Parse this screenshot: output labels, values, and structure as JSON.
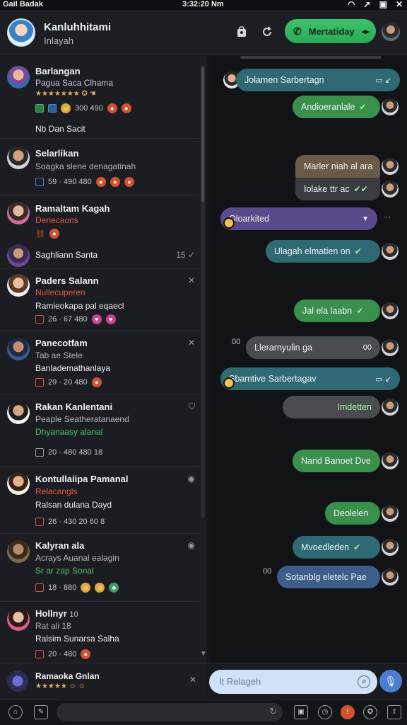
{
  "status": {
    "left": "Gail Badak",
    "time": "3:32:20 Nm",
    "icons": [
      "wifi-icon",
      "signal-icon",
      "battery-icon",
      "close-icon"
    ]
  },
  "header": {
    "title": "Kanluhhitami",
    "subtitle": "Inlayah",
    "call_label": "Mertatiday"
  },
  "contacts": [
    {
      "name": "Barlangan",
      "sub": "Pagua Saca Clhama",
      "sub_color": "#c9cad0",
      "line": "Nb Dan Sacit",
      "meta": "300  490"
    },
    {
      "name": "Selarlikan",
      "sub": "Soagka slene denagatinah",
      "sub_color": "#b3b4ba",
      "meta": "59 · 490  480"
    },
    {
      "name": "Ramaltam Kagah",
      "sub": "Deriecaons",
      "sub_color": "#e15a45"
    },
    {
      "name": "Saghliann Santa",
      "meta_right": "15"
    },
    {
      "name": "Paders Salann",
      "sub": "Nullecuperen",
      "sub_color": "#e15a45",
      "line": "Ramieokapa pal eqaecl",
      "meta": "26 · 67  480"
    },
    {
      "name": "Panecotfam",
      "sub": "Tab ae Stele",
      "sub_color": "#b3b4ba",
      "line": "Banlademathanlaya",
      "meta": "29 · 20  480"
    },
    {
      "name": "Rakan Kanlentani",
      "sub": "Peaple Seatheratanaend",
      "sub_color": "#b3b4ba",
      "line": "Dhyanaasy alanal",
      "line_color": "#4cc46a",
      "meta": "20 · 480  480  18"
    },
    {
      "name": "Kontullaiipa Pamanal",
      "sub": "Relacangls",
      "sub_color": "#e15a45",
      "line": "Ralsan dulana Dayd",
      "meta": "26 · 430  20  60  8"
    },
    {
      "name": "Kalyran ala",
      "sub": "Acrays Auanal ealagin",
      "sub_color": "#b3b4ba",
      "line": "Sr ar zap Sonal",
      "line_color": "#4cc46a",
      "meta": "18 · 880"
    },
    {
      "name": "Hollnyr",
      "name_suffix": "10",
      "sub": "Rat ali 18",
      "sub_color": "#b3b4ba",
      "line": "Ralsim Sunarsa Salha",
      "meta": "20 · 480"
    }
  ],
  "pinned_bottom": {
    "name": "Ramaoka Gnlan"
  },
  "messages": [
    {
      "text": "Jolamen Sarbertagn",
      "style": "teal"
    },
    {
      "text": "Andioeranlale",
      "style": "green"
    },
    {
      "text": "Marler niah al ara",
      "style": "brown"
    },
    {
      "text": "Iolake ttr ac",
      "style": "dark"
    },
    {
      "text": "Oloarkited",
      "style": "purple"
    },
    {
      "text": "Ulagah elmatien on",
      "style": "teal"
    },
    {
      "text": "Jal ela laabn",
      "style": "green"
    },
    {
      "text": "Llerarnyulin ga",
      "style": "gray",
      "side_left": "00",
      "side_right": "00"
    },
    {
      "text": "Sbamtive Sarbertagav",
      "style": "teal"
    },
    {
      "text": "Imdetten",
      "style": "gray"
    },
    {
      "text": "Nand Banoet Dve",
      "style": "green"
    },
    {
      "text": "Deolelen",
      "style": "green"
    },
    {
      "text": "Mvoedleden",
      "style": "teal"
    },
    {
      "text": "Sotanblg eletelc Pae",
      "style": "blue",
      "side_left": "00"
    }
  ],
  "composer": {
    "placeholder": "It Relageh"
  },
  "colors": {
    "accent_green": "#2fb35a",
    "bubble_teal": "#2f6a74",
    "bubble_green": "#3b8f4d",
    "mic_blue": "#4a7fcf"
  }
}
